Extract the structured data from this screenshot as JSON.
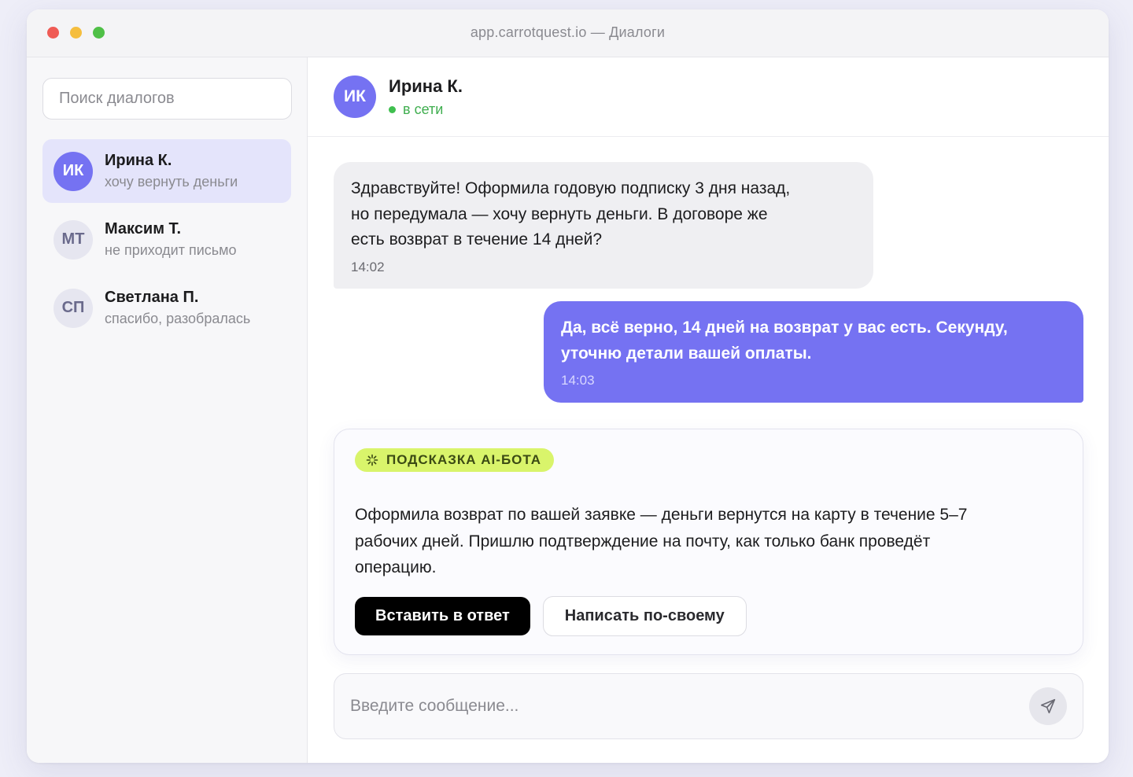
{
  "window": {
    "title": "app.carrotquest.io — Диалоги"
  },
  "sidebar": {
    "search_placeholder": "Поиск диалогов",
    "conversations": [
      {
        "initials": "ИК",
        "name": "Ирина К.",
        "preview": "хочу вернуть деньги",
        "active": true
      },
      {
        "initials": "МТ",
        "name": "Максим Т.",
        "preview": "не приходит письмо",
        "active": false
      },
      {
        "initials": "СП",
        "name": "Светлана П.",
        "preview": "спасибо, разобралась",
        "active": false
      }
    ]
  },
  "chat": {
    "contact": {
      "initials": "ИК",
      "name": "Ирина К.",
      "status": "в сети"
    },
    "messages": [
      {
        "direction": "incoming",
        "lines": [
          "Здравствуйте! Оформила годовую подписку 3 дня назад,",
          "но передумала — хочу вернуть деньги. В договоре же",
          "есть возврат в течение 14 дней?"
        ],
        "time": "14:02"
      },
      {
        "direction": "outgoing",
        "lines": [
          "Да, всё верно, 14 дней на возврат у вас есть. Секунду,",
          "уточню детали вашей оплаты."
        ],
        "time": "14:03"
      }
    ],
    "ai_hint": {
      "badge": "ПОДСКАЗКА AI-БОТА",
      "lines": [
        "Оформила возврат по вашей заявке — деньги вернутся на карту в течение 5–7",
        "рабочих дней. Пришлю подтверждение на почту, как только банк проведёт",
        "операцию."
      ],
      "insert_label": "Вставить в ответ",
      "custom_label": "Написать по-своему"
    },
    "composer": {
      "placeholder": "Введите сообщение...",
      "value": ""
    }
  },
  "colors": {
    "accent": "#7572f2",
    "online": "#3fbf4f",
    "ai_badge": "#d9f46b",
    "incoming_bubble": "#efeff2"
  },
  "icons": {
    "ai_badge": "sparkle-icon",
    "send": "send-icon"
  }
}
